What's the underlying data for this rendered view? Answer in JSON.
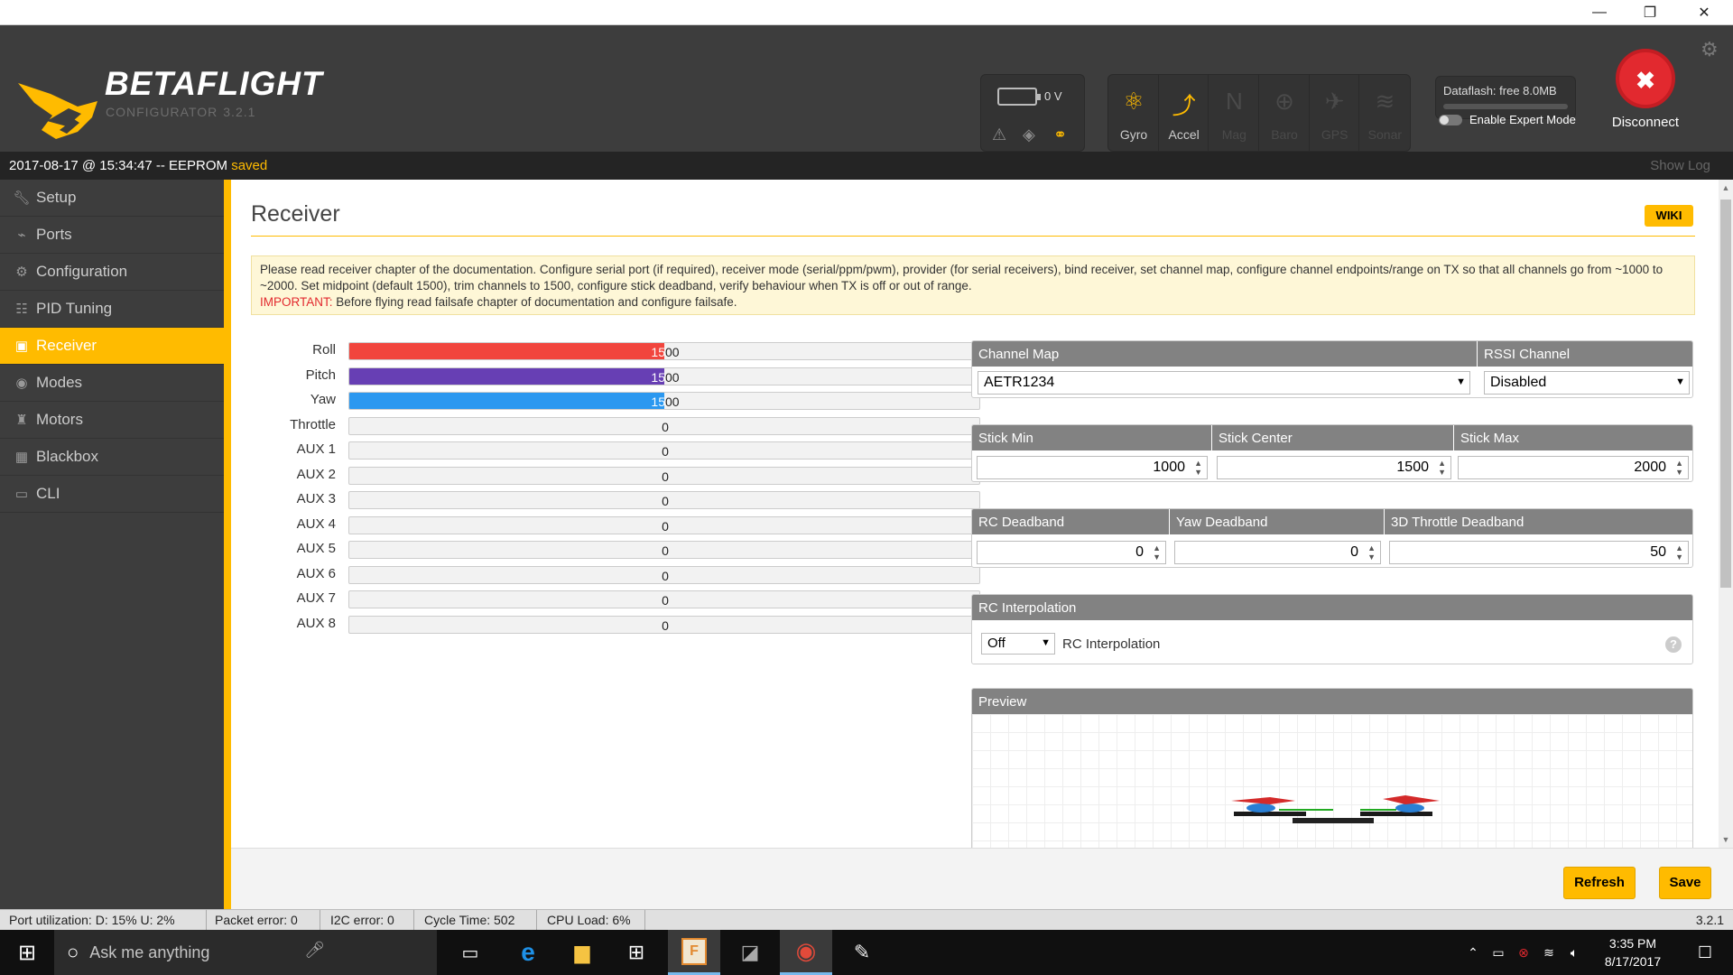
{
  "window": {
    "minimize": "—",
    "restore": "❐",
    "close": "✕"
  },
  "app": {
    "name": "BETAFLIGHT",
    "sub": "CONFIGURATOR",
    "version": "3.2.1"
  },
  "battery": {
    "voltage": "0 V"
  },
  "sensors": [
    {
      "label": "Gyro",
      "icon": "gyro-icon",
      "active": true
    },
    {
      "label": "Accel",
      "icon": "accel-icon",
      "active": true
    },
    {
      "label": "Mag",
      "icon": "mag-icon",
      "active": false
    },
    {
      "label": "Baro",
      "icon": "baro-icon",
      "active": false
    },
    {
      "label": "GPS",
      "icon": "gps-icon",
      "active": false
    },
    {
      "label": "Sonar",
      "icon": "sonar-icon",
      "active": false
    }
  ],
  "dataflash": {
    "label": "Dataflash: free 8.0MB"
  },
  "expert_mode": {
    "label": "Enable Expert Mode",
    "enabled": false
  },
  "disconnect": {
    "label": "Disconnect"
  },
  "log": {
    "text": "2017-08-17 @ 15:34:47 -- EEPROM",
    "status": "saved",
    "show_log": "Show Log"
  },
  "sidebar": {
    "items": [
      {
        "label": "Setup",
        "icon": "wrench-icon"
      },
      {
        "label": "Ports",
        "icon": "plug-icon"
      },
      {
        "label": "Configuration",
        "icon": "gear-icon"
      },
      {
        "label": "PID Tuning",
        "icon": "sliders-icon"
      },
      {
        "label": "Receiver",
        "icon": "receiver-icon",
        "active": true
      },
      {
        "label": "Modes",
        "icon": "modes-icon"
      },
      {
        "label": "Motors",
        "icon": "motor-icon"
      },
      {
        "label": "Blackbox",
        "icon": "blackbox-icon"
      },
      {
        "label": "CLI",
        "icon": "terminal-icon"
      }
    ]
  },
  "page": {
    "title": "Receiver",
    "wiki": "WIKI",
    "note": "Please read receiver chapter of the documentation. Configure serial port (if required), receiver mode (serial/ppm/pwm), provider (for serial receivers), bind receiver, set channel map, configure channel endpoints/range on TX so that all channels go from ~1000 to ~2000. Set midpoint (default 1500), trim channels to 1500, configure stick deadband, verify behaviour when TX is off or out of range.",
    "note_important": "IMPORTANT:",
    "note_important_text": " Before flying read failsafe chapter of documentation and configure failsafe."
  },
  "channels": [
    {
      "label": "Roll",
      "value": "1500",
      "fill": 0.5,
      "color": "#f1453d"
    },
    {
      "label": "Pitch",
      "value": "1500",
      "fill": 0.5,
      "color": "#673fb4"
    },
    {
      "label": "Yaw",
      "value": "1500",
      "fill": 0.5,
      "color": "#2b98f0"
    },
    {
      "label": "Throttle",
      "value": "0",
      "fill": 0,
      "color": "#ffbb00"
    },
    {
      "label": "AUX 1",
      "value": "0",
      "fill": 0,
      "color": "#ccc"
    },
    {
      "label": "AUX 2",
      "value": "0",
      "fill": 0,
      "color": "#ccc"
    },
    {
      "label": "AUX 3",
      "value": "0",
      "fill": 0,
      "color": "#ccc"
    },
    {
      "label": "AUX 4",
      "value": "0",
      "fill": 0,
      "color": "#ccc"
    },
    {
      "label": "AUX 5",
      "value": "0",
      "fill": 0,
      "color": "#ccc"
    },
    {
      "label": "AUX 6",
      "value": "0",
      "fill": 0,
      "color": "#ccc"
    },
    {
      "label": "AUX 7",
      "value": "0",
      "fill": 0,
      "color": "#ccc"
    },
    {
      "label": "AUX 8",
      "value": "0",
      "fill": 0,
      "color": "#ccc"
    }
  ],
  "channel_map": {
    "label": "Channel Map",
    "value": "AETR1234"
  },
  "rssi": {
    "label": "RSSI Channel",
    "value": "Disabled"
  },
  "stick": {
    "min_label": "Stick Min",
    "min": "1000",
    "center_label": "Stick Center",
    "center": "1500",
    "max_label": "Stick Max",
    "max": "2000"
  },
  "deadband": {
    "rc_label": "RC Deadband",
    "rc": "0",
    "yaw_label": "Yaw Deadband",
    "yaw": "0",
    "throttle_label": "3D Throttle Deadband",
    "throttle": "50"
  },
  "interpolation": {
    "header": "RC Interpolation",
    "value": "Off",
    "label": "RC Interpolation",
    "help": "?"
  },
  "preview": {
    "header": "Preview"
  },
  "buttons": {
    "refresh": "Refresh",
    "save": "Save"
  },
  "status": {
    "port": "Port utilization: D: 15% U: 2%",
    "packet": "Packet error: 0",
    "i2c": "I2C error: 0",
    "cycle": "Cycle Time: 502",
    "cpu": "CPU Load: 6%",
    "version": "3.2.1"
  },
  "taskbar": {
    "search": "Ask me anything",
    "time": "3:35 PM",
    "date": "8/17/2017"
  }
}
